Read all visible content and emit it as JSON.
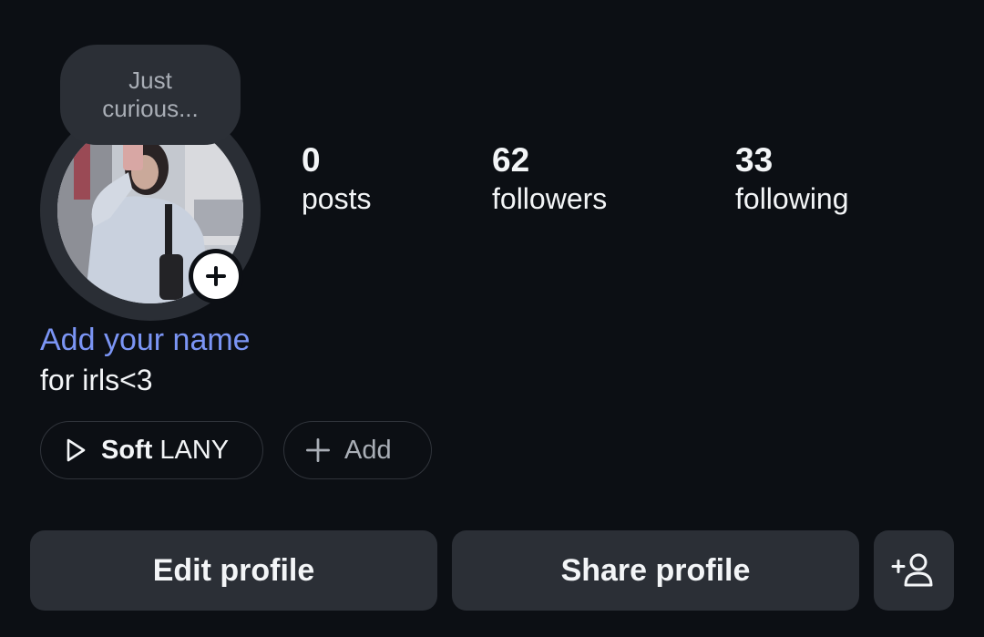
{
  "note": {
    "text_line1": "Just",
    "text_line2": "curious..."
  },
  "profile": {
    "add_name_prompt": "Add your name",
    "bio": "for irls<3"
  },
  "stats": [
    {
      "value": "0",
      "label": "posts"
    },
    {
      "value": "62",
      "label": "followers"
    },
    {
      "value": "33",
      "label": "following"
    }
  ],
  "music": {
    "icon": "play-icon",
    "song": "Soft",
    "artist": "LANY"
  },
  "add_pill": {
    "icon": "plus-icon",
    "label": "Add"
  },
  "buttons": {
    "edit": "Edit profile",
    "share": "Share profile",
    "suggest_icon": "add-person-icon"
  },
  "colors": {
    "background": "#0c0f14",
    "surface": "#2b2f36",
    "accent_link": "#7b95f5",
    "text": "#f3f5f7",
    "muted": "#a9aeb6"
  }
}
